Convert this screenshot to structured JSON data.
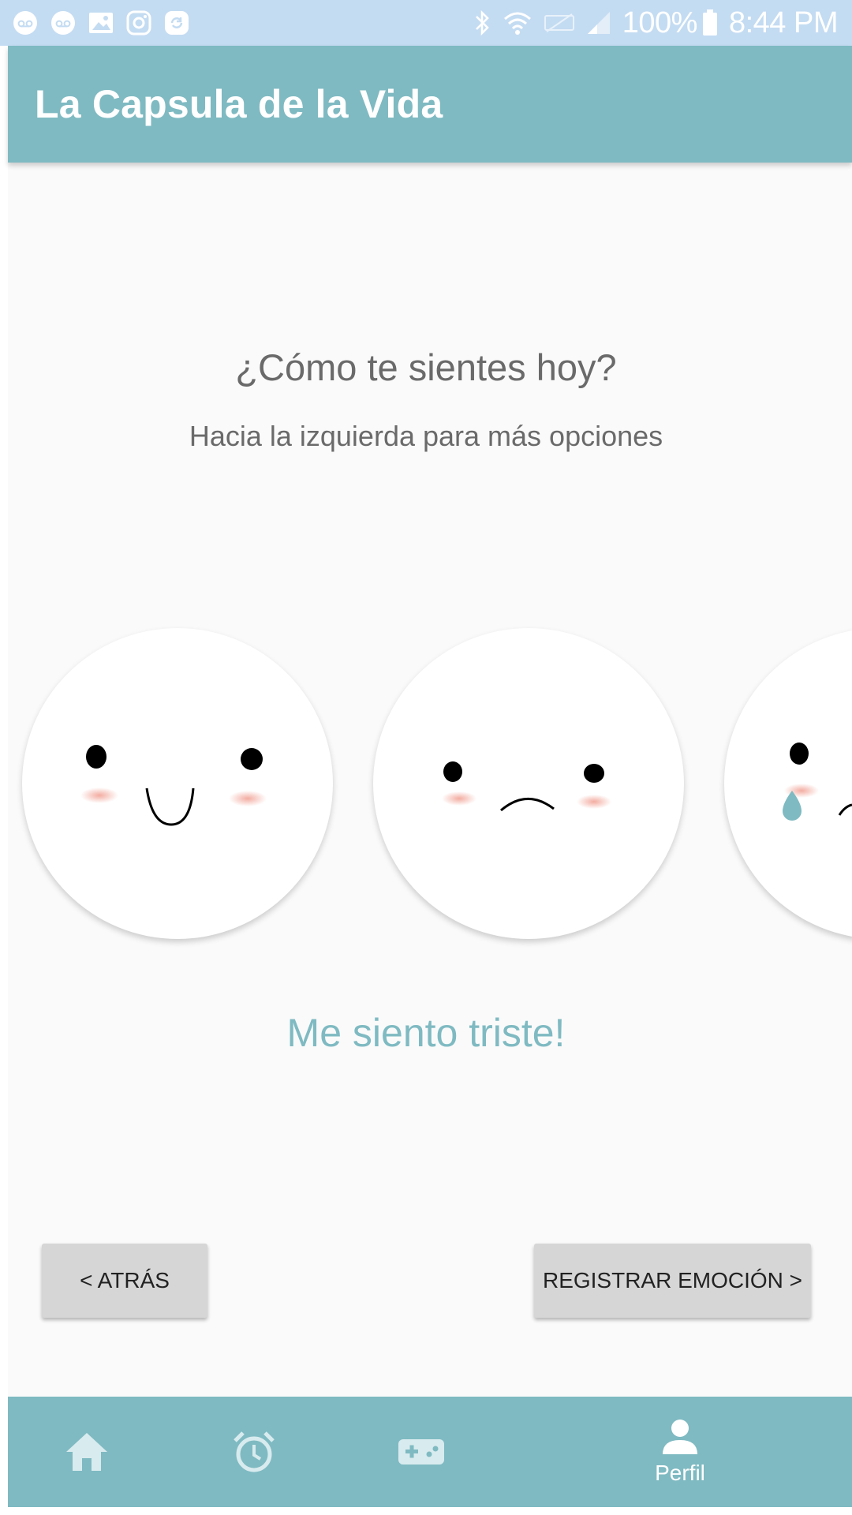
{
  "status_bar": {
    "battery": "100%",
    "time": "8:44 PM",
    "icons_left": [
      "voicemail-icon",
      "voicemail-icon",
      "image-icon",
      "instagram-icon",
      "sync-icon"
    ],
    "icons_right": [
      "bluetooth-icon",
      "wifi-icon",
      "no-sim-icon",
      "signal-icon",
      "battery-icon"
    ]
  },
  "app_bar": {
    "title": "La Capsula de la Vida"
  },
  "main": {
    "question": "¿Cómo te sientes hoy?",
    "hint": "Hacia la izquierda para más opciones",
    "faces": [
      "happy-face",
      "sad-face",
      "crying-face"
    ],
    "selected_feeling": "Me siento triste!"
  },
  "buttons": {
    "back": "< ATRÁS",
    "register": "REGISTRAR EMOCIÓN >"
  },
  "bottom_nav": {
    "items": [
      {
        "icon": "home-icon"
      },
      {
        "icon": "alarm-clock-icon"
      },
      {
        "icon": "gamepad-icon"
      },
      {
        "icon": "person-icon",
        "label": "Perfil"
      }
    ]
  },
  "colors": {
    "accent": "#7fbac2",
    "status_bar": "#c4dcf2",
    "button": "#d6d6d6",
    "text_gray": "#6a6a6a",
    "blush": "#f2b8ae",
    "tear": "#7fbac2"
  }
}
